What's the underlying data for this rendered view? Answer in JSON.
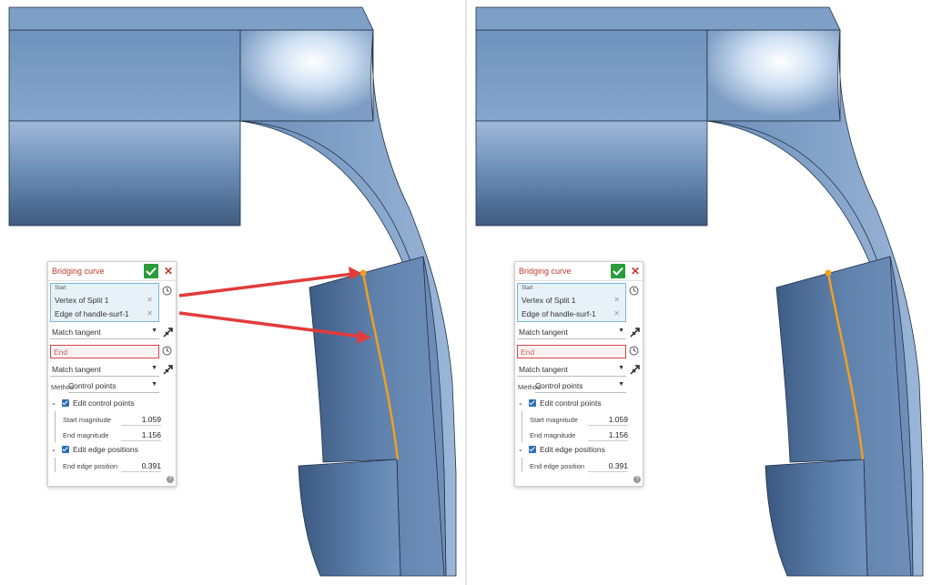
{
  "dialog": {
    "title": "Bridging curve",
    "start_label": "Start",
    "start_items": [
      "Vertex of Split 1",
      "Edge of handle-surf-1"
    ],
    "start_match": "Match tangent",
    "end_placeholder": "End",
    "end_match": "Match tangent",
    "method_label": "Method",
    "method_value": "Control points",
    "edit_control_points_label": "Edit control points",
    "start_magnitude_label": "Start magnitude",
    "start_magnitude": "1.059",
    "end_magnitude_label": "End magnitude",
    "end_magnitude": "1.156",
    "edit_edge_positions_label": "Edit edge positions",
    "end_edge_position_label": "End edge position",
    "end_edge_position": "0.391",
    "help_glyph": "?"
  },
  "colors": {
    "ok_green": "#2a9d3a",
    "title_red": "#c0392b",
    "curve_orange": "#f0a020",
    "arrow_red": "#e23b3b",
    "selection_blue": "#e6f1f8"
  },
  "icons": [
    "confirm-check-icon",
    "close-x-icon",
    "clock-icon",
    "flip-direction-icon",
    "chevron-down-icon",
    "checkbox-checked-icon",
    "help-icon"
  ]
}
